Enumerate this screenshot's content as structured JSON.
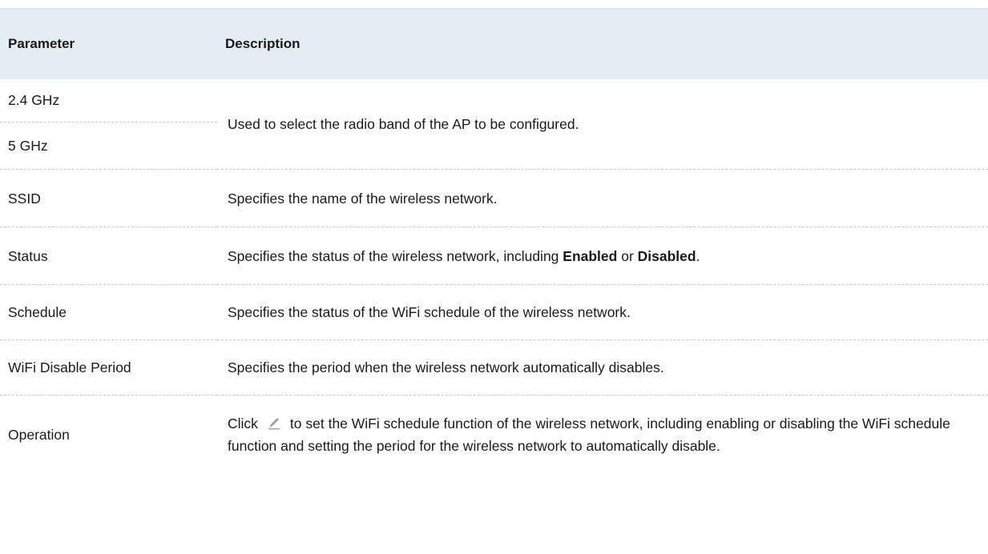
{
  "table": {
    "headers": {
      "parameter": "Parameter",
      "description": "Description"
    },
    "band": {
      "param_24": "2.4 GHz",
      "param_5": "5 GHz",
      "desc": "Used to select the radio band of the AP to be configured."
    },
    "ssid": {
      "param": "SSID",
      "desc": "Specifies the name of the wireless network."
    },
    "status": {
      "param": "Status",
      "desc_prefix": "Specifies the status of the wireless network, including ",
      "enabled": "Enabled",
      "or": " or ",
      "disabled": "Disabled",
      "period": "."
    },
    "schedule": {
      "param": "Schedule",
      "desc": "Specifies the status of the WiFi schedule of the wireless network."
    },
    "disable_period": {
      "param": "WiFi Disable Period",
      "desc": "Specifies the period when the wireless network automatically disables."
    },
    "operation": {
      "param": "Operation",
      "click": "Click",
      "icon": "edit-pencil-icon",
      "desc": "to set the WiFi schedule function of the wireless network, including enabling or disabling the WiFi schedule function and setting the period for the wireless network to automatically disable."
    }
  },
  "colors": {
    "header_bg": "#e3edf4",
    "divider": "#c8c8c8",
    "icon_gray": "#a0a0a0"
  }
}
